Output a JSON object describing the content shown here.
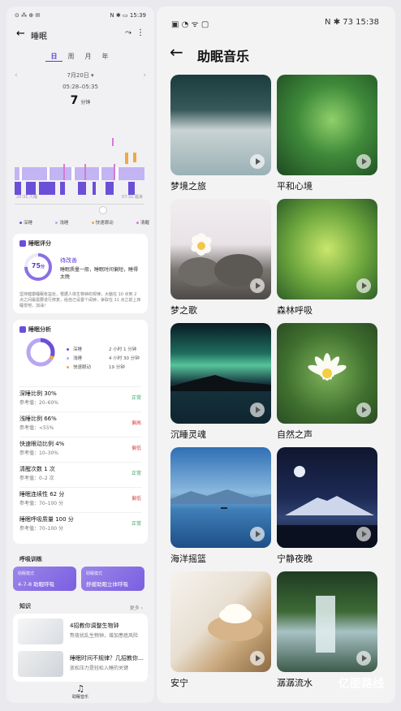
{
  "left": {
    "status": {
      "left": "⊙ ⁂ ⊕ ✉",
      "right": "N ✱ ▭ 15:39"
    },
    "header": {
      "title": "睡眠"
    },
    "tabs": [
      "日",
      "周",
      "月",
      "年"
    ],
    "date": "7月20日",
    "time_range": "05:28–05:35",
    "duration_value": "7",
    "duration_unit": "分钟",
    "chart": {
      "start": "20:31 入睡",
      "end": "07:31 醒来"
    },
    "legend": [
      "深睡",
      "浅睡",
      "快速眼动",
      "清醒"
    ],
    "score_card": {
      "title": "睡眠评分",
      "score": "75",
      "score_unit": "分",
      "level": "待改善",
      "desc": "睡眠质量一般，睡眠时间偏短，睡得太晚",
      "note": "坚持健康睡眠有益处，根据人体生物钟的规律，大脑在 10 点到 2 点之间最需要进行修复，给自己设置个闹钟，争取在 11 点之前上床睡觉吧，加油！"
    },
    "analysis": {
      "title": "睡眠分析",
      "stages": [
        {
          "name": "深睡",
          "value": "2 小时 1 分钟",
          "color": "#6b4fd8"
        },
        {
          "name": "浅睡",
          "value": "4 小时 30 分钟",
          "color": "#b8a6f2"
        },
        {
          "name": "快速眼动",
          "value": "19 分钟",
          "color": "#f1a64a"
        }
      ],
      "metrics": [
        {
          "title": "深睡比例 30%",
          "ref": "参考值：20–60%",
          "status": "正常",
          "cls": "ok"
        },
        {
          "title": "浅睡比例 66%",
          "ref": "参考值：<55%",
          "status": "偏高",
          "cls": "hi"
        },
        {
          "title": "快速眼动比例 4%",
          "ref": "参考值：10–30%",
          "status": "偏低",
          "cls": "lo"
        },
        {
          "title": "清醒次数 1 次",
          "ref": "参考值：0–2 次",
          "status": "正常",
          "cls": "ok"
        },
        {
          "title": "睡眠连续性 62 分",
          "ref": "参考值：70–100 分",
          "status": "偏低",
          "cls": "lo"
        },
        {
          "title": "睡眠呼吸质量 100 分",
          "ref": "参考值：70–100 分",
          "status": "正常",
          "cls": "ok"
        }
      ]
    },
    "breathing": {
      "title": "呼吸训练",
      "items": [
        {
          "mode": "助眠模式",
          "name": "4-7-8 助眠呼吸"
        },
        {
          "mode": "助眠模式",
          "name": "舒缓助眠立体呼吸"
        }
      ]
    },
    "knowledge": {
      "title": "知识",
      "more": "更多 ›",
      "items": [
        {
          "title": "4招教你调整生物钟",
          "sub": "熬夜扰乱生物钟，增加患癌风险"
        },
        {
          "title": "睡眠时间不规律？几招教你…",
          "sub": "放松压力是轻松入睡的关键"
        }
      ]
    },
    "bottom_nav": {
      "label": "助眠音乐"
    }
  },
  "right": {
    "status": {
      "left": "▣ ◔ ᯤ ▢",
      "right": "N ✱ 73 15:38"
    },
    "header": {
      "title": "助眠音乐"
    },
    "tiles": [
      {
        "label": "梦境之旅"
      },
      {
        "label": "平和心境"
      },
      {
        "label": "梦之歌"
      },
      {
        "label": "森林呼吸"
      },
      {
        "label": "沉睡灵魂"
      },
      {
        "label": "自然之声"
      },
      {
        "label": "海洋摇篮"
      },
      {
        "label": "宁静夜晚"
      },
      {
        "label": "安宁"
      },
      {
        "label": "潺潺流水"
      }
    ],
    "watermark": "亿图路线"
  }
}
